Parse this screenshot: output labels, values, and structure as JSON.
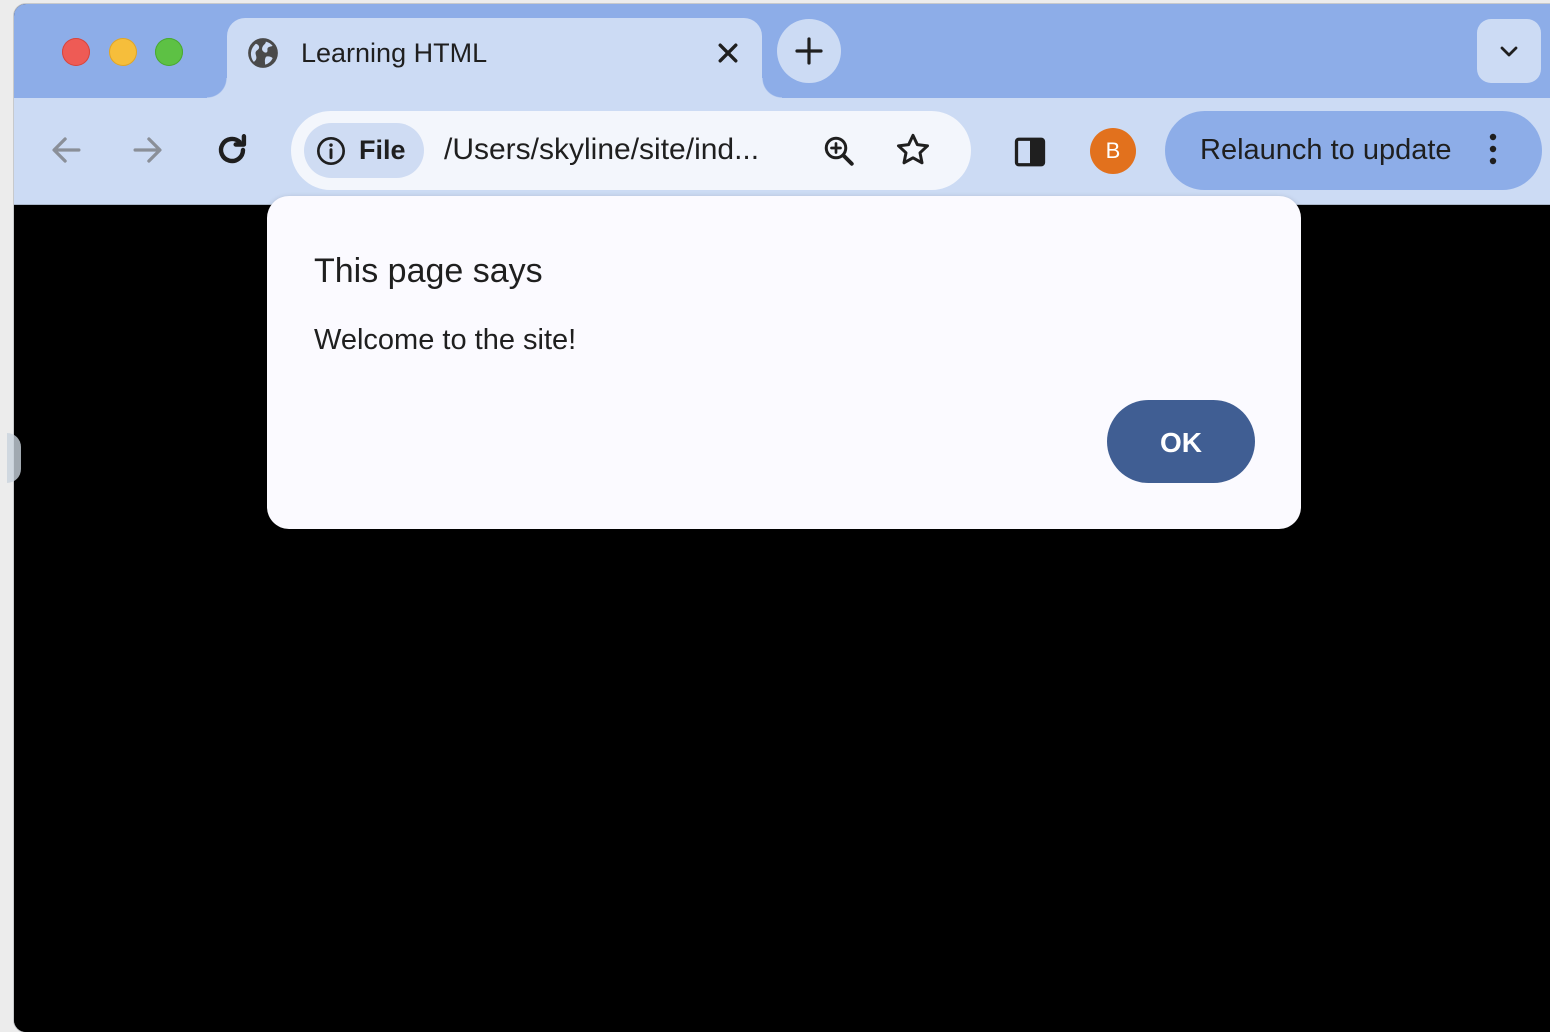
{
  "tab": {
    "title": "Learning HTML",
    "favicon": "globe-icon"
  },
  "toolbar": {
    "security_chip_label": "File",
    "url": "/Users/skyline/site/ind...",
    "profile_initial": "B",
    "relaunch_label": "Relaunch to update"
  },
  "dialog": {
    "title": "This page says",
    "message": "Welcome to the site!",
    "ok_label": "OK"
  },
  "colors": {
    "tabstrip": "#8dade8",
    "toolbar": "#ccdbf4",
    "ok_button": "#405e93",
    "avatar": "#e2711d",
    "content": "#000000"
  }
}
